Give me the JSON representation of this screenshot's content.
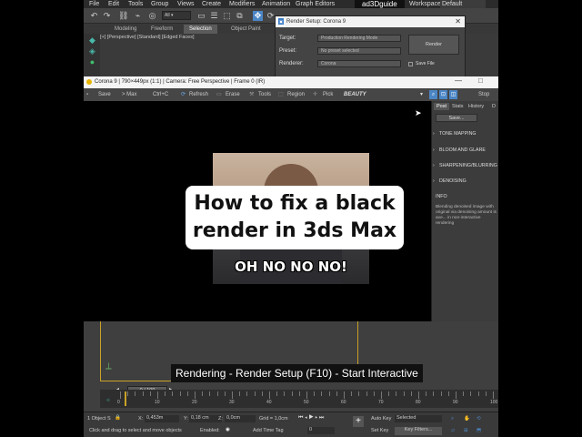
{
  "menu": [
    "File",
    "Edit",
    "Tools",
    "Group",
    "Views",
    "Create",
    "Modifiers",
    "Animation",
    "Graph Editors"
  ],
  "app_tab": "ad3Dguide",
  "workspaces_label": "Workspaces:",
  "workspaces_value": "Default",
  "ribbon_tabs": [
    "Modeling",
    "Freeform",
    "Selection",
    "Object Paint"
  ],
  "viewport_label": "[+] [Perspective] [Standard] [Edged Faces]",
  "render_setup": {
    "title": "Render Setup: Corona 9",
    "target_label": "Target:",
    "target_value": "Production Rendering Mode",
    "preset_label": "Preset:",
    "preset_value": "No preset selected",
    "renderer_label": "Renderer:",
    "renderer_value": "Corona",
    "render_button": "Render",
    "save_file": "Save File"
  },
  "vfb": {
    "title": "Corona 9 | 790×449px (1:1) | Camera: Free Perspective | Frame 0 (IR)",
    "toolbar": {
      "save": "Save",
      "max": "> Max",
      "ctrlc": "Ctrl+C",
      "refresh": "Refresh",
      "erase": "Erase",
      "tools": "Tools",
      "region": "Region",
      "pick": "Pick",
      "beauty": "BEAUTY",
      "stop": "Stop"
    },
    "panel_tabs": [
      "Post",
      "Stats",
      "History",
      "D"
    ],
    "panel_save": "Save...",
    "sections": [
      "TONE MAPPING",
      "BLOOM AND GLARE",
      "SHARPENING/BLURRING",
      "DENOISING",
      "INFO"
    ],
    "info_text": "Blending denoised image with original via denoising amount is ave... in non-interactive rendering"
  },
  "overlay": {
    "title_line1": "How to fix a black",
    "title_line2": "render in 3ds Max",
    "meme_text": "OH NO NO NO!",
    "caption": "Rendering - Render Setup (F10) - Start Interactive"
  },
  "timeline": {
    "frame": "0 / 100",
    "ticks": [
      "0",
      "10",
      "20",
      "30",
      "40",
      "50",
      "60",
      "70",
      "80",
      "90",
      "100"
    ]
  },
  "status": {
    "selection": "1 Object S",
    "x_label": "X:",
    "x_value": "0,453m",
    "y_label": "Y:",
    "y_value": "0,18 cm",
    "z_label": "Z:",
    "z_value": "0,0cm",
    "grid": "Grid = 1,0cm",
    "prompt": "Click and drag to select and move objects",
    "enabled": "Enabled:",
    "add_time_tag": "Add Time Tag",
    "auto_key": "Auto Key",
    "set_key": "Set Key",
    "key_mode": "Selected",
    "key_filters": "Key Filters...",
    "frame_field": "0"
  }
}
